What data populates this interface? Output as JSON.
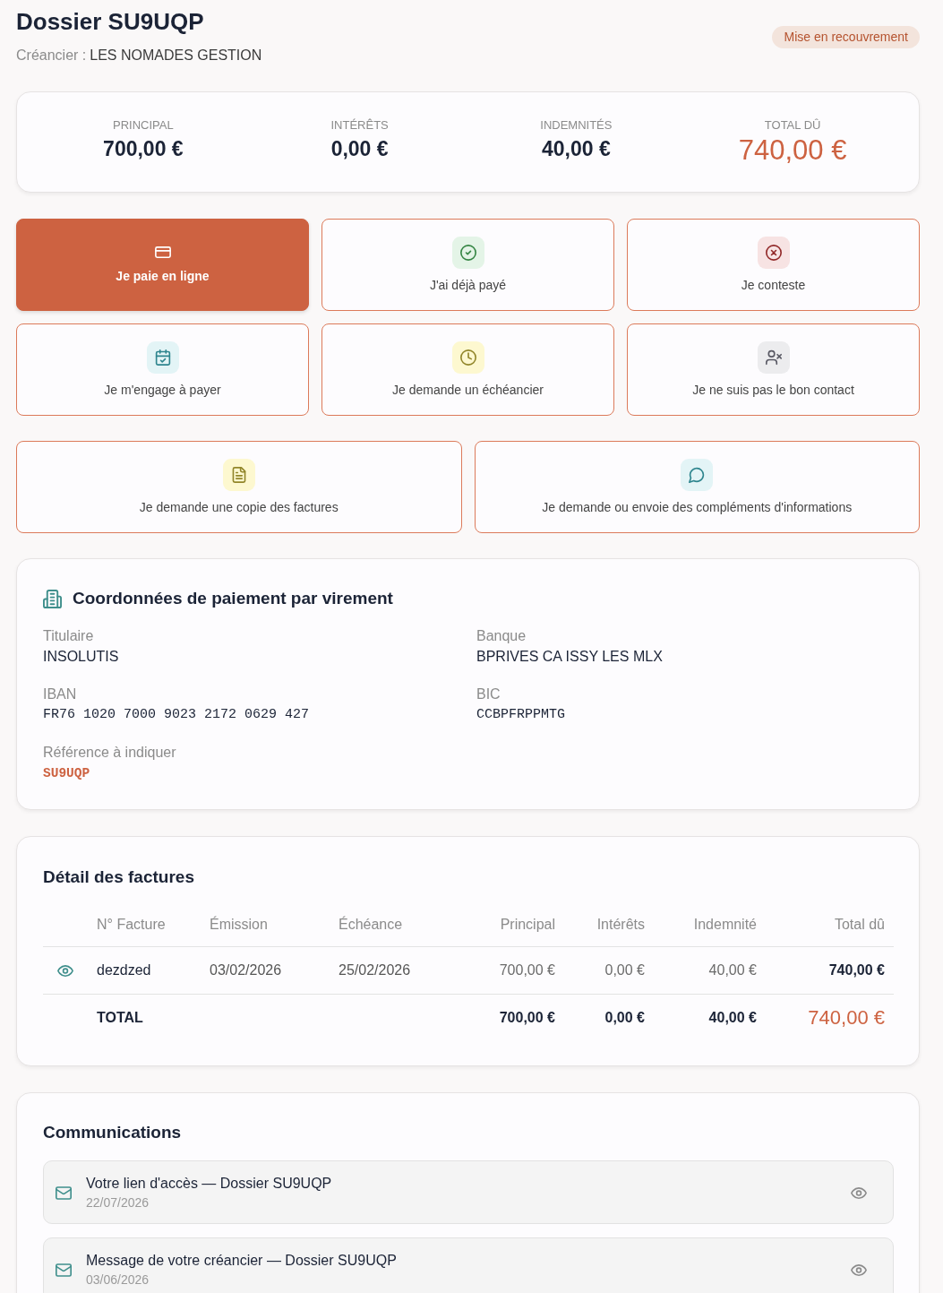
{
  "header": {
    "title": "Dossier SU9UQP",
    "creditor_label": "Créancier :",
    "creditor": "LES NOMADES GESTION",
    "status_badge": "Mise en recouvrement"
  },
  "summary": [
    {
      "label": "PRINCIPAL",
      "value": "700,00 €",
      "kind": "amount"
    },
    {
      "label": "INTÉRÊTS",
      "value": "0,00 €",
      "kind": "amount"
    },
    {
      "label": "INDEMNITÉS",
      "value": "40,00 €",
      "kind": "amount"
    },
    {
      "label": "TOTAL DÛ",
      "value": "740,00 €",
      "kind": "total"
    }
  ],
  "action_groups": [
    {
      "items": [
        {
          "label": "Je paie en ligne",
          "kind": "primary"
        },
        {
          "label": "J'ai déjà payé",
          "kind": "option",
          "color": "#e4f4e7"
        },
        {
          "label": "Je conteste",
          "kind": "option",
          "color": "#f7e3e3"
        },
        {
          "label": "Je m'engage à payer",
          "kind": "option",
          "color": "#e3f4f6"
        },
        {
          "label": "Je demande un échéancier",
          "kind": "option",
          "color": "#fdf8d0"
        },
        {
          "label": "Je ne suis pas le bon contact",
          "kind": "option",
          "color": "#ececee"
        }
      ]
    },
    {
      "items": [
        {
          "label": "Je demande une copie des factures",
          "kind": "option",
          "color": "#fdf8d0"
        },
        {
          "label": "Je demande ou envoie des compléments d'informations",
          "kind": "option",
          "color": "#e3f4f6"
        }
      ]
    }
  ],
  "bank_transfer": {
    "title": "Coordonnées de paiement par virement",
    "fields": [
      {
        "label": "Titulaire",
        "value": "INSOLUTIS",
        "kind": "text"
      },
      {
        "label": "Banque",
        "value": "BPRIVES CA ISSY LES MLX",
        "kind": "text"
      },
      {
        "label": "IBAN",
        "value": "FR76 1020 7000 9023 2172 0629 427",
        "kind": "code"
      },
      {
        "label": "BIC",
        "value": "CCBPFRPPMTG",
        "kind": "code"
      },
      {
        "label": "Référence à indiquer",
        "value": "SU9UQP",
        "kind": "reference"
      }
    ]
  },
  "invoices": {
    "title": "Détail des factures",
    "columns": [
      "N° Facture",
      "Émission",
      "Échéance",
      "Principal",
      "Intérêts",
      "Indemnité",
      "Total dû"
    ],
    "rows": [
      {
        "number": "dezdzed",
        "issued": "03/02/2026",
        "due": "25/02/2026",
        "principal": "700,00 €",
        "interest": "0,00 €",
        "indemnity": "40,00 €",
        "total": "740,00 €"
      }
    ],
    "total_row": {
      "label": "TOTAL",
      "principal": "700,00 €",
      "interest": "0,00 €",
      "indemnity": "40,00 €",
      "total": "740,00 €"
    }
  },
  "communications": {
    "title": "Communications",
    "items": [
      {
        "subject": "Votre lien d'accès — Dossier SU9UQP",
        "date": "22/07/2026"
      },
      {
        "subject": "Message de votre créancier — Dossier SU9UQP",
        "date": "03/06/2026"
      }
    ]
  }
}
